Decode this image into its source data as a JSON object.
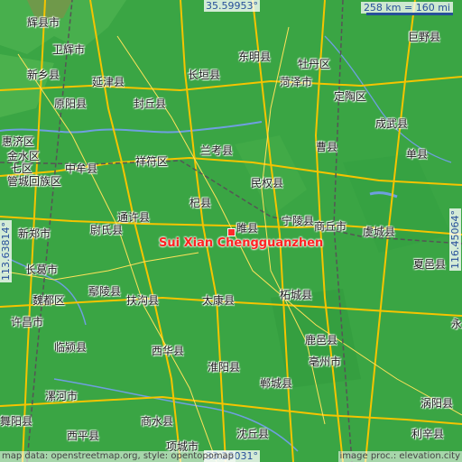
{
  "map": {
    "location_label": "Sui Xian Chengguanzhen",
    "scale_label": "258 km = 160 mi",
    "coords": {
      "top": "35.59953°",
      "bottom": "33.28031°",
      "left": "113.63814°",
      "right": "116.45064°"
    },
    "attribution_left": "map data: openstreetmap.org, style: opentopomap",
    "attribution_right": "image proc.: elevation.city",
    "colors": {
      "land": "#3aa544",
      "water": "#6f9fe0",
      "road": "#f5c400",
      "rail": "#555555",
      "marker": "#ff2a2a"
    }
  },
  "places": [
    "辉县市",
    "卫辉市",
    "新乡县",
    "原阳县",
    "延津县",
    "长垣县",
    "封丘县",
    "东明县",
    "牡丹区",
    "菏泽市",
    "定陶区",
    "巨野县",
    "成武县",
    "惠济区",
    "金水区",
    "七区",
    "管城回族区",
    "中牟县",
    "祥符区",
    "兰考县",
    "曹县",
    "民权县",
    "杞县",
    "睢县",
    "宁陵县",
    "商丘市",
    "虞城县",
    "单县",
    "新郑市",
    "尉氏县",
    "通许县",
    "长葛市",
    "鄢陵县",
    "扶沟县",
    "太康县",
    "柘城县",
    "夏邑县",
    "魏都区",
    "许昌市",
    "临颍县",
    "西华县",
    "淮阳县",
    "鹿邑县",
    "亳州市",
    "郸城县",
    "漯河市",
    "舞阳县",
    "西平县",
    "商水县",
    "项城市",
    "沈丘县",
    "涡阳县",
    "利辛县",
    "永"
  ]
}
